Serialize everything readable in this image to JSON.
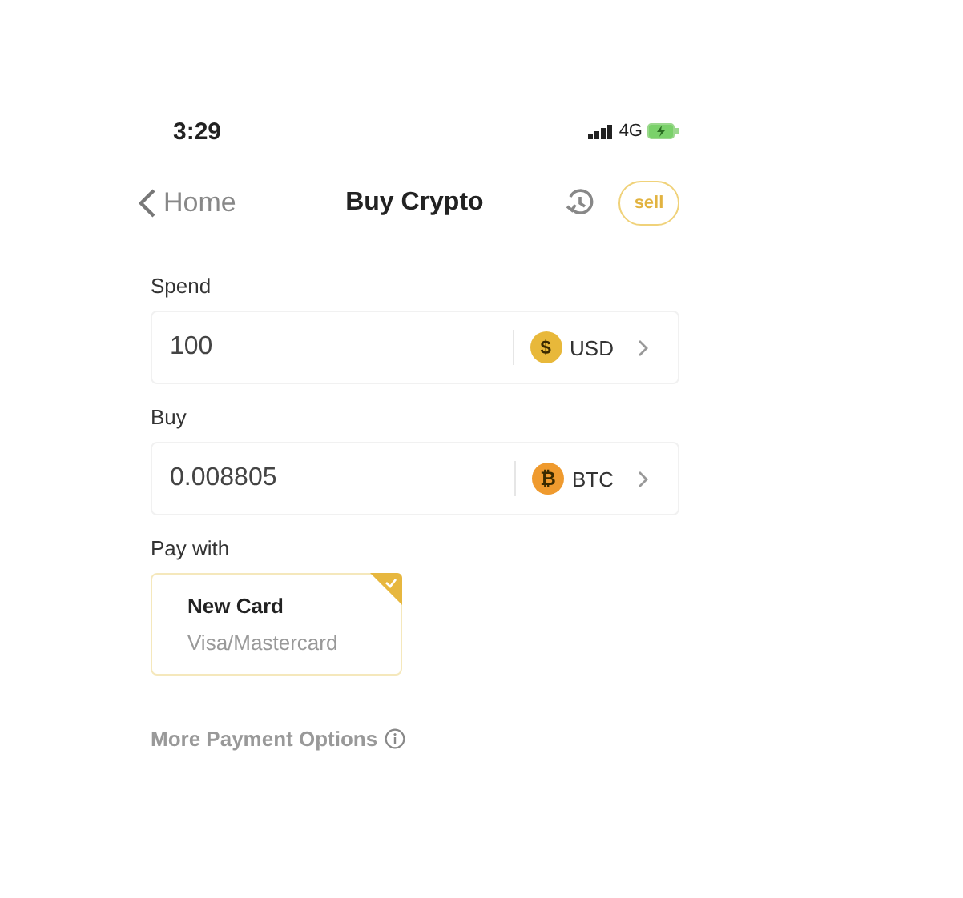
{
  "status_bar": {
    "time": "3:29",
    "network": "4G"
  },
  "nav": {
    "back_label": "Home",
    "title": "Buy Crypto",
    "sell_button": "sell"
  },
  "fields": [
    {
      "label": "Spend",
      "value": "100",
      "currency": {
        "symbol": "$",
        "code": "USD",
        "color": "#e8b83a"
      }
    },
    {
      "label": "Buy",
      "value": "0.008805",
      "currency": {
        "symbol": "₿",
        "code": "BTC",
        "color": "#ef9a2e"
      }
    }
  ],
  "pay_with": {
    "label": "Pay with",
    "methods": [
      {
        "title": "New Card",
        "subtitle": "Visa/Mastercard",
        "selected": true
      }
    ]
  },
  "more_options": "More Payment Options"
}
